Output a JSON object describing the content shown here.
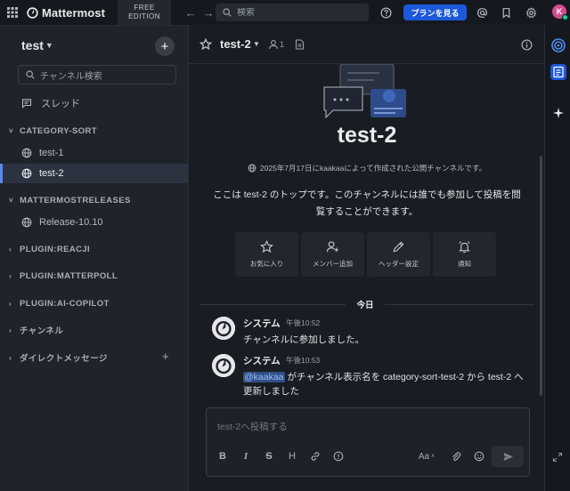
{
  "topbar": {
    "brand": "Mattermost",
    "edition_line1": "FREE",
    "edition_line2": "EDITION",
    "search_placeholder": "検索",
    "plan_button": "プランを見る",
    "avatar_initial": "K"
  },
  "sidebar": {
    "team_name": "test",
    "channel_search": "チャンネル検索",
    "threads": "スレッド",
    "categories": [
      {
        "label": "CATEGORY-SORT",
        "expanded": true
      },
      {
        "label": "MATTERMOSTRELEASES",
        "expanded": true
      },
      {
        "label": "PLUGIN:REACJI",
        "expanded": false
      },
      {
        "label": "PLUGIN:MATTERPOLL",
        "expanded": false
      },
      {
        "label": "PLUGIN:AI-COPILOT",
        "expanded": false
      },
      {
        "label": "チャンネル",
        "expanded": false
      },
      {
        "label": "ダイレクトメッセージ",
        "expanded": false
      }
    ],
    "channels": {
      "test1": "test-1",
      "test2": "test-2",
      "release": "Release-10.10"
    },
    "active_channel": "test-2"
  },
  "channel": {
    "name": "test-2",
    "member_count": "1",
    "intro_meta": "2025年7月17日にkaakaaによって作成された公開チャンネルです。",
    "intro_desc_line1": "ここは test-2 のトップです。このチャンネルには誰でも参加して投稿を閲",
    "intro_desc_line2": "覧することができます。",
    "actions": [
      "お気に入り",
      "メンバー追加",
      "ヘッダー設定",
      "通知"
    ],
    "date_separator": "今日"
  },
  "posts": [
    {
      "author": "システム",
      "time": "午後10:52",
      "text": "チャンネルに参加しました。"
    },
    {
      "author": "システム",
      "time": "午後10:53",
      "mention": "@kaakaa",
      "text": " がチャンネル表示名を category-sort-test-2 から test-2 へ更新しました"
    }
  ],
  "composer": {
    "placeholder": "test-2へ投稿する",
    "heading_label": "H",
    "bold_label": "B",
    "italic_label": "I",
    "strike_label": "S",
    "font_label": "Aa"
  },
  "colors": {
    "accent": "#1c58d9",
    "active_border": "#5d89ea",
    "avatar": "#d24d8f",
    "status_online": "#06d6a0"
  }
}
